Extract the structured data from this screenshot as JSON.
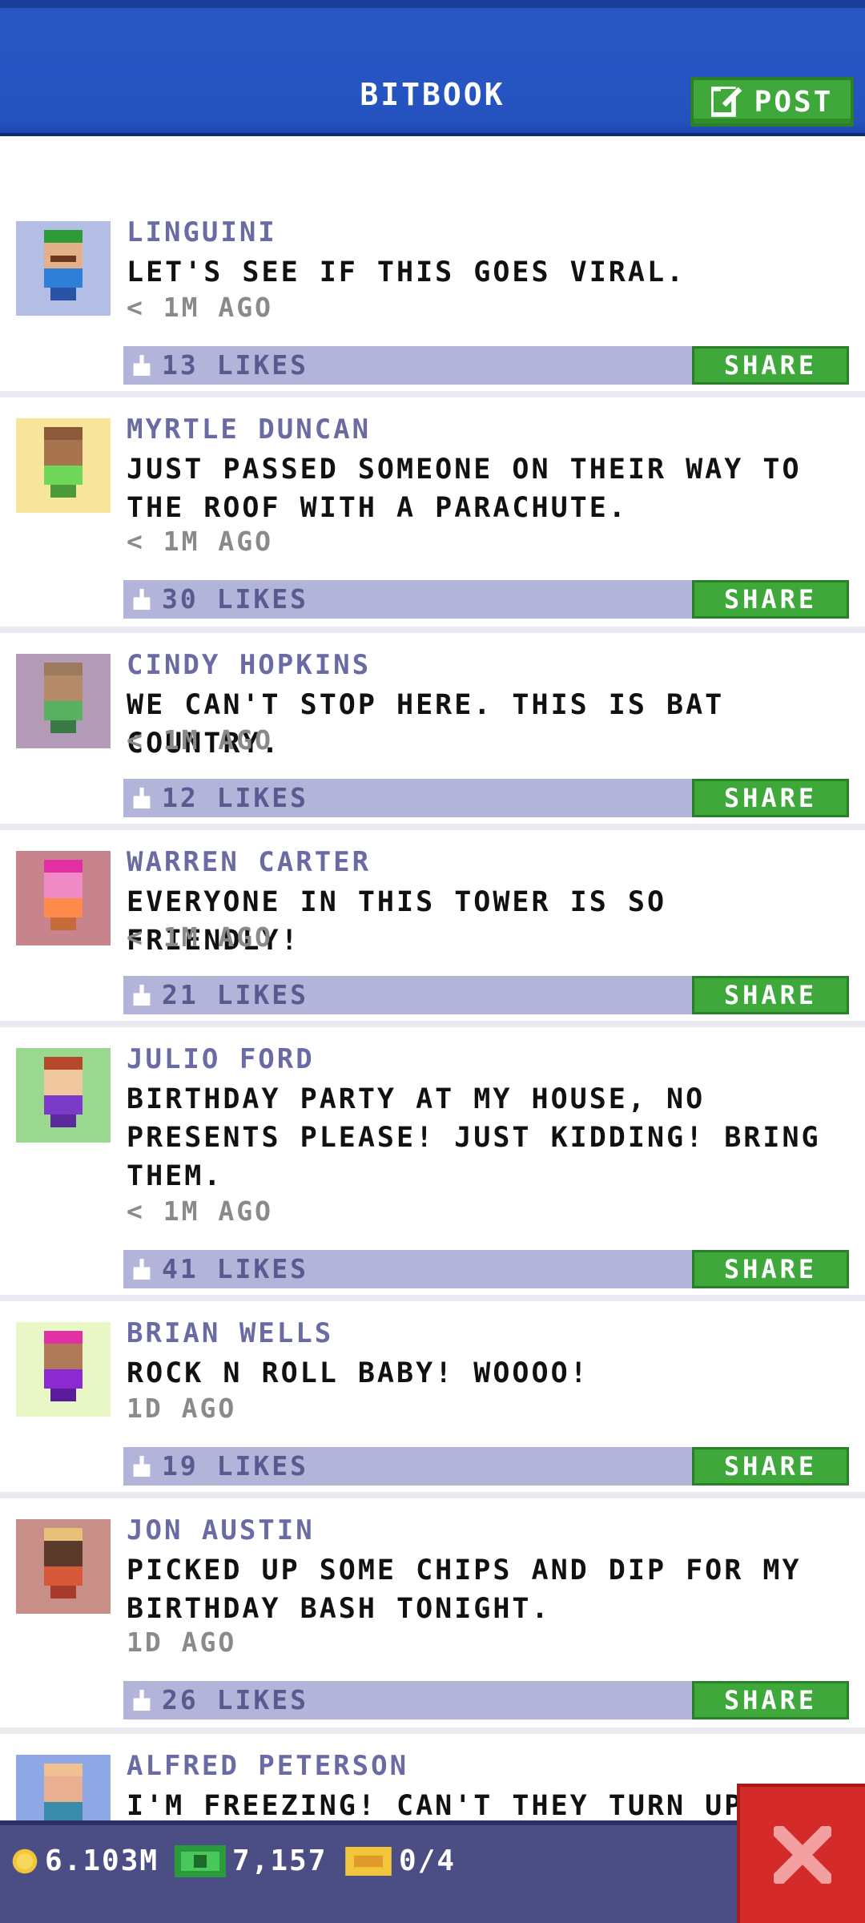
{
  "header": {
    "title": "BITBOOK",
    "post_label": "POST"
  },
  "share_label": "SHARE",
  "posts": [
    {
      "name": "LINGUINI",
      "text": "LET'S SEE IF THIS GOES VIRAL.",
      "time": "< 1M AGO",
      "likes": "13 LIKES",
      "bg": "#b4bde3"
    },
    {
      "name": "MYRTLE DUNCAN",
      "text": "JUST PASSED SOMEONE ON THEIR WAY TO THE ROOF WITH A PARACHUTE.",
      "time": "< 1M AGO",
      "likes": "30 LIKES",
      "bg": "#f6e59a"
    },
    {
      "name": "CINDY HOPKINS",
      "text": "WE CAN'T STOP HERE. THIS IS BAT COUNTRY.",
      "time": "< 1M AGO",
      "likes": "12 LIKES",
      "bg": "#b39ab7"
    },
    {
      "name": "WARREN CARTER",
      "text": "EVERYONE IN THIS TOWER IS SO FRIENDLY!",
      "time": "< 1M AGO",
      "likes": "21 LIKES",
      "bg": "#c7848c"
    },
    {
      "name": "JULIO FORD",
      "text": "BIRTHDAY PARTY AT MY HOUSE, NO PRESENTS PLEASE! JUST KIDDING! BRING THEM.",
      "time": "< 1M AGO",
      "likes": "41 LIKES",
      "bg": "#9ad88f"
    },
    {
      "name": "BRIAN WELLS",
      "text": "ROCK N ROLL BABY! WOOOO!",
      "time": "1D AGO",
      "likes": "19 LIKES",
      "bg": "#e9f7c6"
    },
    {
      "name": "JON AUSTIN",
      "text": "PICKED UP SOME CHIPS AND DIP FOR MY BIRTHDAY BASH TONIGHT.",
      "time": "1D AGO",
      "likes": "26 LIKES",
      "bg": "#c88e88"
    },
    {
      "name": "ALFRED PETERSON",
      "text": "I'M FREEZING! CAN'T THEY TURN UP THE",
      "time": "",
      "likes": "",
      "bg": "#8ea8e6"
    }
  ],
  "status": {
    "coins": "6.103M",
    "bux": "7,157",
    "tickets": "0/4"
  },
  "icons": [
    "edit-icon",
    "thumbs-up-icon",
    "coin-icon",
    "bux-icon",
    "ticket-icon",
    "close-icon"
  ],
  "colors": {
    "header_blue": "#2453c0",
    "button_green": "#3ea83b",
    "like_bar": "#b3b4d9",
    "close_red": "#d42a2a",
    "bottom_bar": "#4a4e84"
  }
}
